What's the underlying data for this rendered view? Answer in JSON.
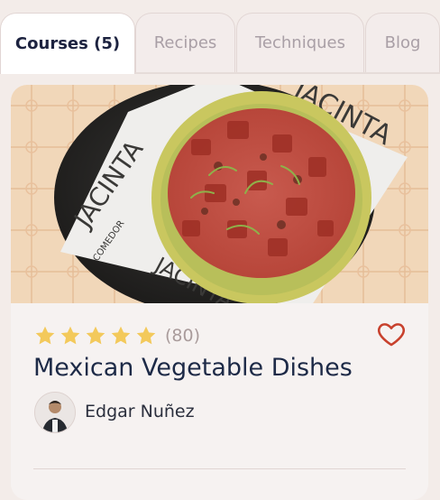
{
  "tabs": [
    {
      "label": "Courses (5)",
      "active": true
    },
    {
      "label": "Recipes",
      "active": false
    },
    {
      "label": "Techniques",
      "active": false
    },
    {
      "label": "Blog",
      "active": false
    }
  ],
  "card": {
    "image_icon": "tostada-dish-photo",
    "plate_text": "JACINTA",
    "plate_subtext": "COMEDOR",
    "rating": {
      "stars": 5,
      "count": "(80)"
    },
    "title": "Mexican Vegetable Dishes",
    "author": "Edgar Nuñez",
    "favorite_icon": "heart-icon"
  },
  "colors": {
    "background": "#f3ece9",
    "card": "#f6f2f1",
    "star": "#f3c95b",
    "heart": "#c8412d",
    "title": "#1d2a47"
  }
}
